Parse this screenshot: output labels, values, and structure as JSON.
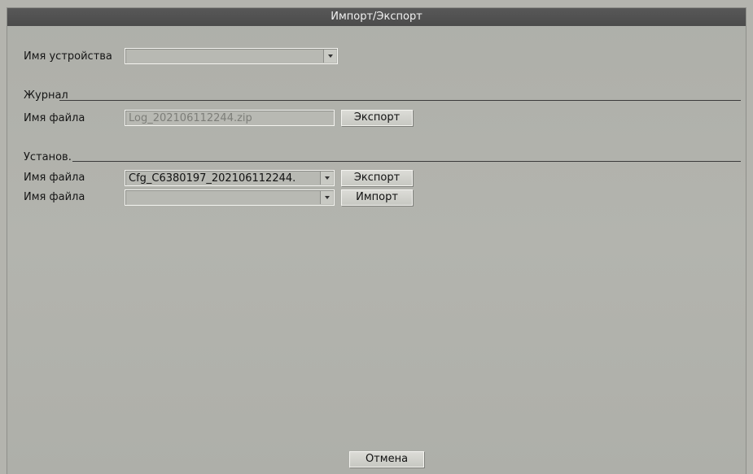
{
  "window": {
    "title": "Импорт/Экспорт"
  },
  "device": {
    "label": "Имя устройства",
    "value": ""
  },
  "journal": {
    "section_title": "Журнал",
    "file_label": "Имя файла",
    "file_value": "Log_202106112244.zip",
    "export_label": "Экспорт"
  },
  "settings": {
    "section_title": "Установ.",
    "export_row": {
      "label": "Имя файла",
      "value": "Cfg_C6380197_202106112244.",
      "button": "Экспорт"
    },
    "import_row": {
      "label": "Имя файла",
      "value": "",
      "button": "Импорт"
    }
  },
  "footer": {
    "cancel_label": "Отмена"
  }
}
